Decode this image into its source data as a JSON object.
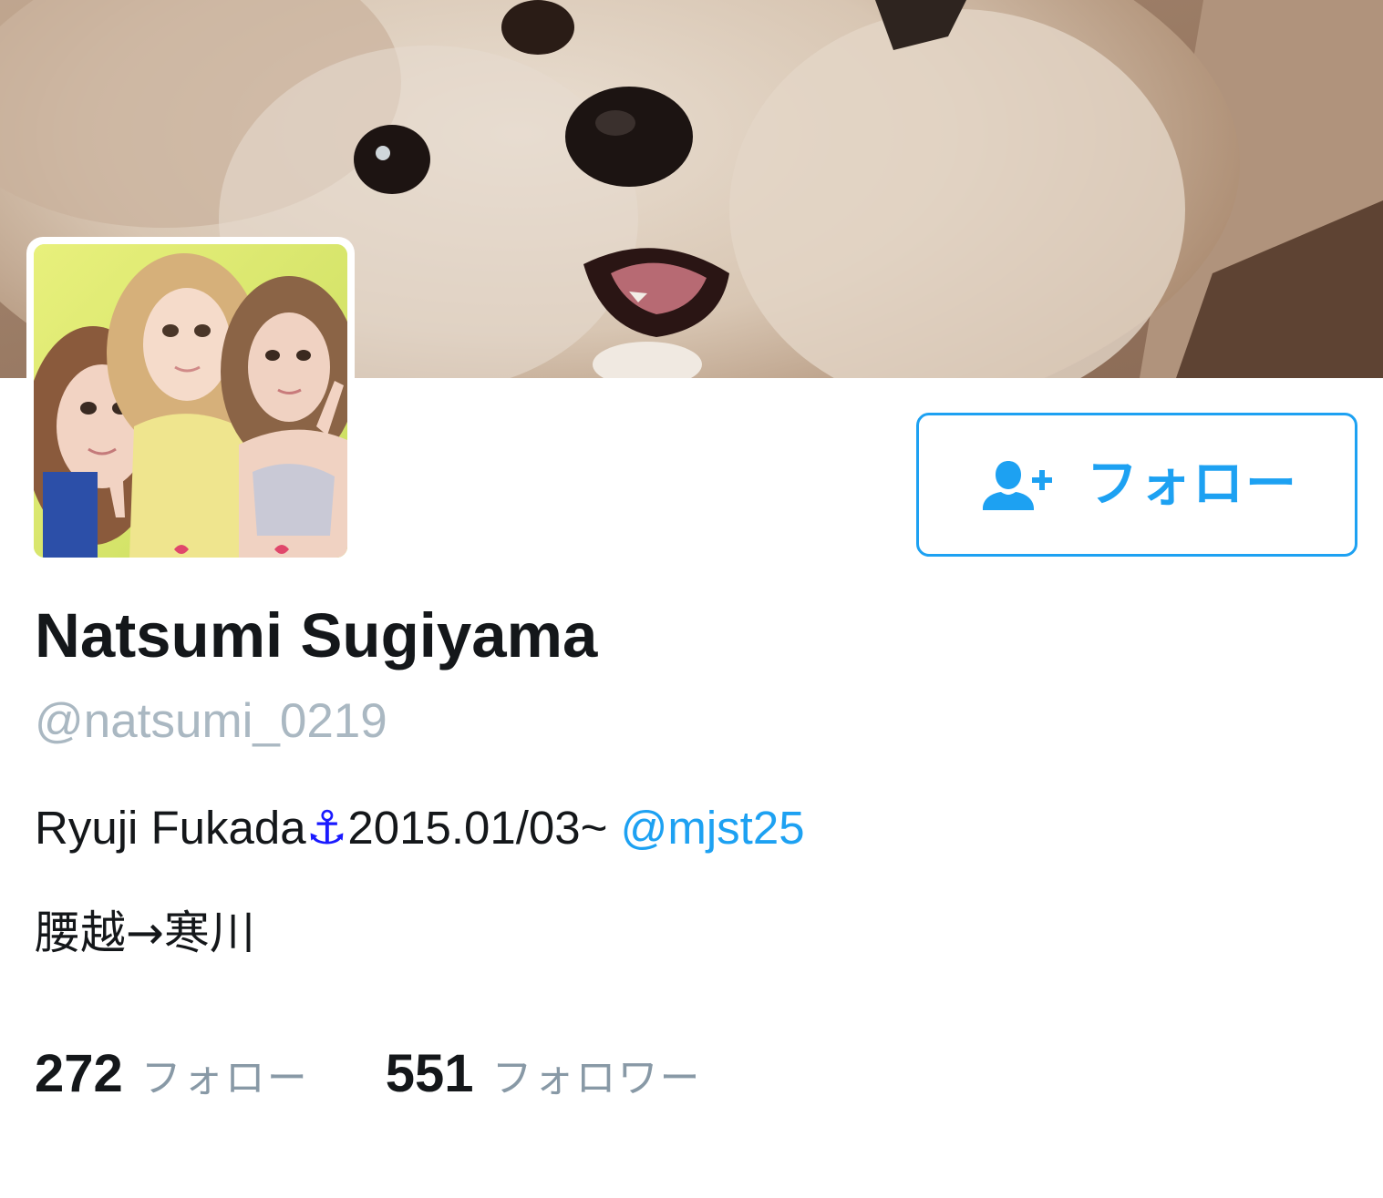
{
  "profile": {
    "display_name": "Natsumi Sugiyama",
    "handle": "@natsumi_0219",
    "bio": {
      "line1_prefix": "Ryuji Fukada",
      "line1_anchor": "⚓",
      "line1_date": "2015.01/03~",
      "line1_mention": "@mjst25",
      "line2": "腰越→寒川"
    }
  },
  "follow_button": {
    "label": "フォロー",
    "icon": "add-user-icon"
  },
  "stats": {
    "following_count": "272",
    "following_label": "フォロー",
    "followers_count": "551",
    "followers_label": "フォロワー"
  },
  "colors": {
    "accent": "#1da1f2",
    "text": "#14171a",
    "muted": "#aab8c2",
    "stat_label": "#8899a6"
  }
}
